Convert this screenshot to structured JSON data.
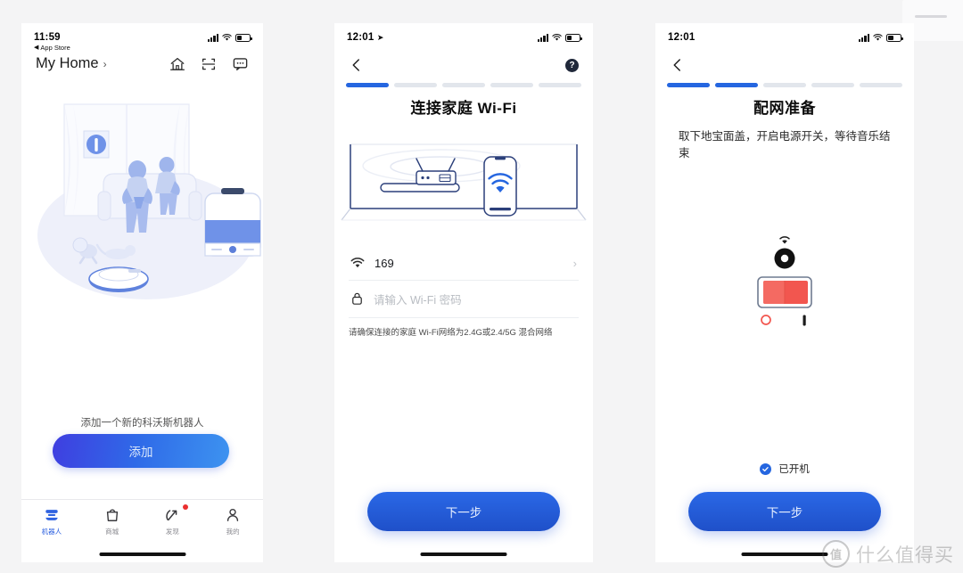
{
  "panel1": {
    "status": {
      "time": "11:59",
      "back_app": "App Store"
    },
    "header": {
      "title": "My Home",
      "chevron": "›"
    },
    "header_icons": [
      {
        "name": "home-icon",
        "label": "home"
      },
      {
        "name": "scan-icon",
        "label": "scan"
      },
      {
        "name": "message-icon",
        "label": "message"
      }
    ],
    "illustration": "family-living-room-with-robot-vacuum",
    "add_hint": "添加一个新的科沃斯机器人",
    "add_button": "添加",
    "tabs": [
      {
        "label": "机器人",
        "icon": "robot-icon",
        "active": true,
        "badge": false
      },
      {
        "label": "商城",
        "icon": "bag-icon",
        "active": false,
        "badge": false
      },
      {
        "label": "发现",
        "icon": "compass-icon",
        "active": false,
        "badge": true
      },
      {
        "label": "我的",
        "icon": "person-icon",
        "active": false,
        "badge": false
      }
    ]
  },
  "panel2": {
    "status": {
      "time": "12:01"
    },
    "nav": {
      "back": "‹",
      "help": "?"
    },
    "progress": {
      "total": 5,
      "filled": 1
    },
    "title": "连接家庭 Wi-Fi",
    "illustration": "router-broadcasting-wifi-to-phone",
    "ssid_value": "169",
    "password_placeholder": "请输入 Wi-Fi 密码",
    "row_arrow": "›",
    "hint": "请确保连接的家庭 Wi-Fi网络为2.4G或2.4/5G 混合网络",
    "next_button": "下一步"
  },
  "panel3": {
    "status": {
      "time": "12:01"
    },
    "nav": {
      "back": "‹"
    },
    "progress": {
      "total": 5,
      "filled": 2
    },
    "title": "配网准备",
    "description": "取下地宝面盖，开启电源开关，等待音乐结束",
    "illustration": "red-power-rocker-switch-with-wifi-indicator",
    "checkbox_label": "已开机",
    "checkbox_checked": true,
    "next_button": "下一步"
  },
  "watermark": {
    "logo": "值",
    "text": "什么值得买"
  },
  "colors": {
    "accent_blue": "#2566e0",
    "progress_track": "#e2e6ec",
    "switch_red": "#f2564f",
    "badge_red": "#ea2f2f",
    "page_bg": "#f4f4f5"
  }
}
